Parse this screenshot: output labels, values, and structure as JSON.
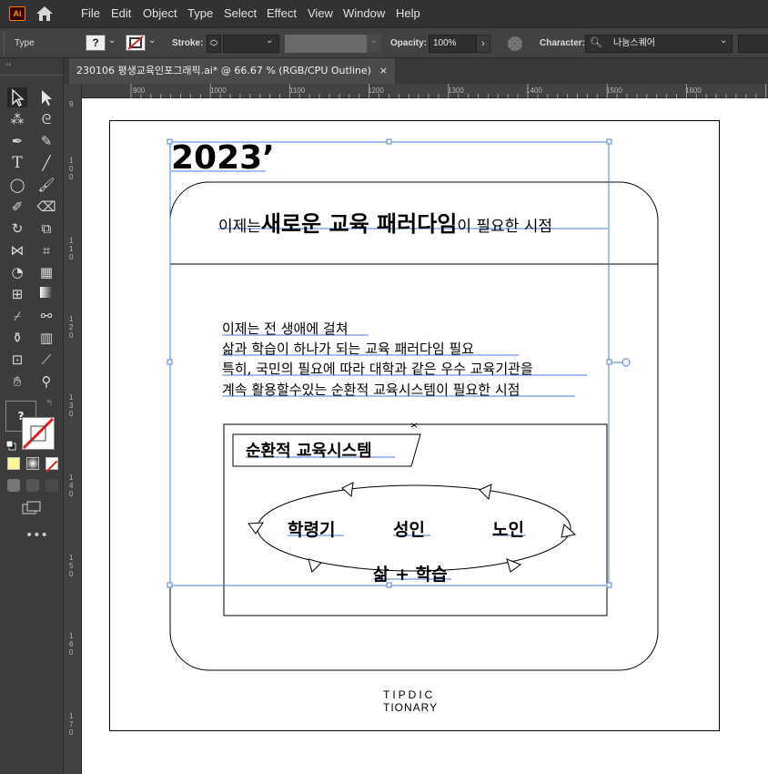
{
  "menubar": {
    "app_logo": "Ai",
    "items": [
      "File",
      "Edit",
      "Object",
      "Type",
      "Select",
      "Effect",
      "View",
      "Window",
      "Help"
    ]
  },
  "controlbar": {
    "selection_type": "Type",
    "stroke_label": "Stroke:",
    "opacity_label": "Opacity:",
    "opacity_value": "100%",
    "character_label": "Character:",
    "font_value": "나눔스퀘어"
  },
  "tab": {
    "title": "230106 평생교육인포그래픽.ai* @ 66.67 % (RGB/CPU Outline)",
    "close_glyph": "×"
  },
  "ruler": {
    "top_marks": [
      "900",
      "1000",
      "1100",
      "1200",
      "1300",
      "1400",
      "1500",
      "1600"
    ],
    "left_marks": [
      "9",
      "1\n0\n0",
      "1\n1\n0",
      "1\n2\n0",
      "1\n3\n0",
      "1\n4\n0",
      "1\n5\n0",
      "1\n6\n0",
      "1\n7\n0"
    ]
  },
  "artwork": {
    "year": "2023’",
    "headline": {
      "part1": "이제는",
      "emphasis": "새로운 교육 패러다임",
      "part2": "이 필요한 시점"
    },
    "body_lines": [
      "이제는 전 생애에 걸쳐",
      "삶과 학습이 하나가 되는 교육 패러다임 필요",
      "특히, 국민의 필요에 따라 대학과 같은 우수 교육기관을",
      "계속 활용할수있는 순환적 교육시스템이 필요한 시점"
    ],
    "system_title": "순환적 교육시스템",
    "stages": [
      "학령기",
      "성인",
      "노인"
    ],
    "cycle_label": "삶 + 학습",
    "brand_line1": "TIPDIC",
    "brand_line2": "TIONARY"
  },
  "colors": {
    "selection": "#4a7fd8",
    "ui_dark": "#323232",
    "ui_panel": "#424242"
  }
}
